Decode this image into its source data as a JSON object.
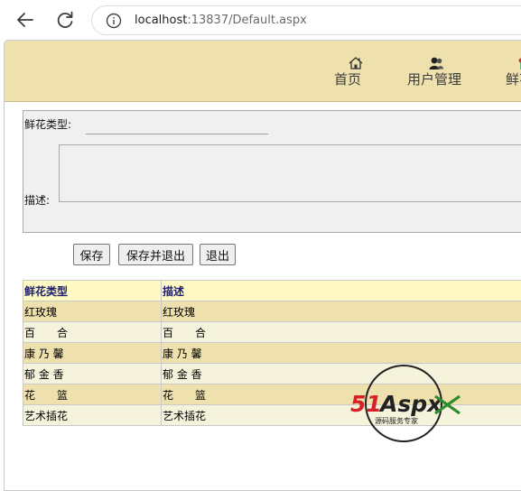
{
  "browser": {
    "url_host": "localhost",
    "url_path": ":13837/Default.aspx"
  },
  "nav": {
    "items": [
      {
        "label": "首页",
        "icon": "home-icon"
      },
      {
        "label": "用户管理",
        "icon": "users-icon"
      },
      {
        "label": "鲜花",
        "icon": "flower-icon"
      }
    ]
  },
  "form": {
    "type_label": "鲜花类型:",
    "type_value": "",
    "desc_label": "描述:",
    "desc_value": ""
  },
  "buttons": {
    "save": "保存",
    "save_exit": "保存并退出",
    "exit": "退出"
  },
  "table": {
    "headers": [
      "鲜花类型",
      "描述"
    ],
    "rows": [
      [
        "红玫瑰",
        "红玫瑰"
      ],
      [
        "百　　合",
        "百　　合"
      ],
      [
        "康 乃 馨",
        "康 乃 馨"
      ],
      [
        "郁 金 香",
        "郁 金 香"
      ],
      [
        "花　　篮",
        "花　　篮"
      ],
      [
        "艺术插花",
        "艺术插花"
      ]
    ]
  },
  "watermark": {
    "brand_num": "51",
    "brand_word": "Aspx",
    "tagline": "源码服务专家"
  },
  "colors": {
    "header_band": "#efe1ad",
    "table_header": "#fffac4",
    "row_odd": "#efe1ad",
    "row_even": "#f6f3dc",
    "header_text": "#20206f",
    "brand_red": "#d8202a",
    "brand_green": "#2e8b2e"
  }
}
